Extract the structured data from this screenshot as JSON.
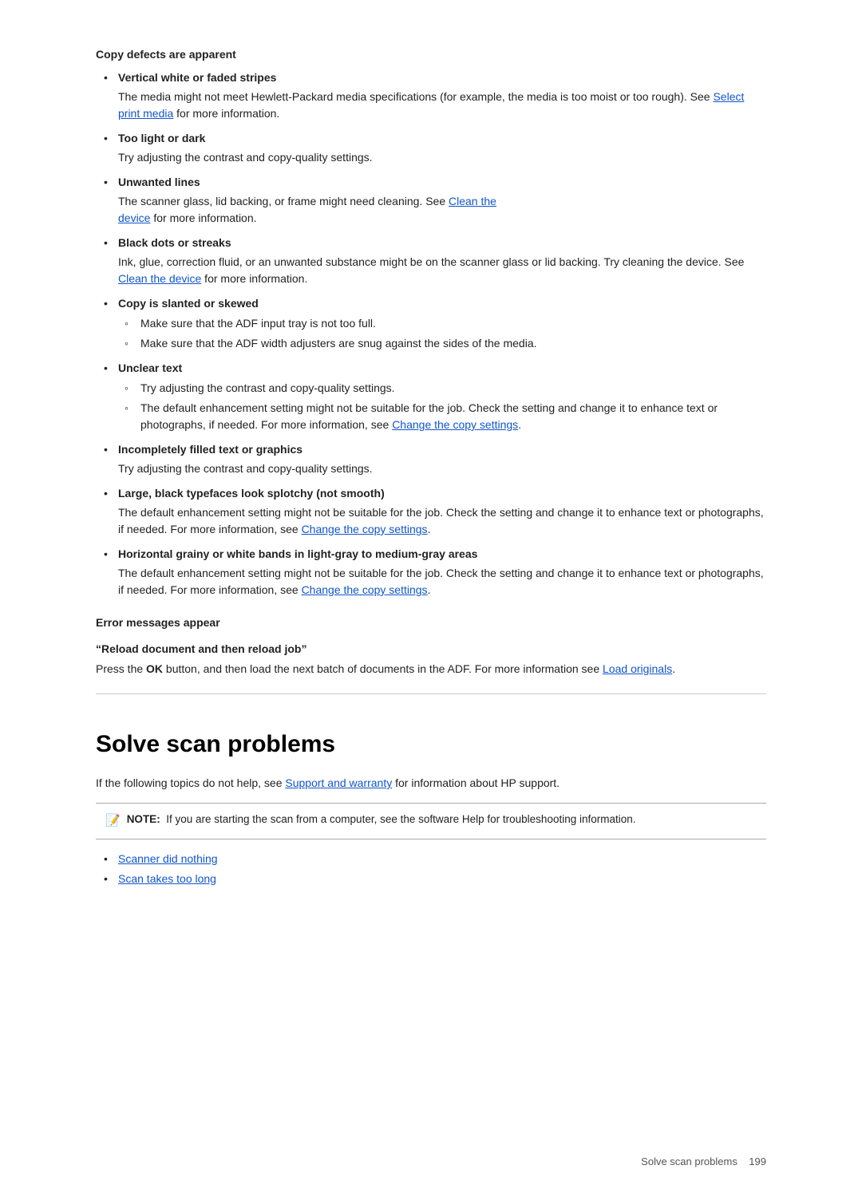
{
  "page": {
    "footer_text": "Solve scan problems",
    "footer_page": "199"
  },
  "copy_defects": {
    "heading": "Copy defects are apparent",
    "items": [
      {
        "title": "Vertical white or faded stripes",
        "body": "The media might not meet Hewlett-Packard media specifications (for example, the media is too moist or too rough). See ",
        "link_text": "Select print media",
        "body_after": " for more information."
      },
      {
        "title": "Too light or dark",
        "body": "Try adjusting the contrast and copy-quality settings."
      },
      {
        "title": "Unwanted lines",
        "body": "The scanner glass, lid backing, or frame might need cleaning. See ",
        "link_text": "Clean the device",
        "body_after": " for more information."
      },
      {
        "title": "Black dots or streaks",
        "body": "Ink, glue, correction fluid, or an unwanted substance might be on the scanner glass or lid backing. Try cleaning the device. See ",
        "link_text": "Clean the device",
        "body_after": " for more information."
      },
      {
        "title": "Copy is slanted or skewed",
        "subitems": [
          "Make sure that the ADF input tray is not too full.",
          "Make sure that the ADF width adjusters are snug against the sides of the media."
        ]
      },
      {
        "title": "Unclear text",
        "subitems": [
          "Try adjusting the contrast and copy-quality settings.",
          "The default enhancement setting might not be suitable for the job. Check the setting and change it to enhance text or photographs, if needed. For more information, see [Change the copy settings]."
        ]
      },
      {
        "title": "Incompletely filled text or graphics",
        "body": "Try adjusting the contrast and copy-quality settings."
      },
      {
        "title": "Large, black typefaces look splotchy (not smooth)",
        "body": "The default enhancement setting might not be suitable for the job. Check the setting and change it to enhance text or photographs, if needed. For more information, see ",
        "link_text": "Change the copy settings",
        "body_after": "."
      },
      {
        "title": "Horizontal grainy or white bands in light-gray to medium-gray areas",
        "body": "The default enhancement setting might not be suitable for the job. Check the setting and change it to enhance text or photographs, if needed. For more information, see ",
        "link_text": "Change the copy settings",
        "body_after": "."
      }
    ]
  },
  "error_messages": {
    "heading": "Error messages appear",
    "sub_heading": "“Reload document and then reload job”",
    "body": "Press the ",
    "bold_ok": "OK",
    "body_after": " button, and then load the next batch of documents in the ADF. For more information see ",
    "link_text": "Load originals",
    "body_end": "."
  },
  "solve_scan": {
    "heading": "Solve scan problems",
    "intro": "If the following topics do not help, see ",
    "link_text": "Support and warranty",
    "intro_after": " for information about HP support.",
    "note_label": "NOTE:",
    "note_body": "If you are starting the scan from a computer, see the software Help for troubleshooting information.",
    "links": [
      {
        "text": "Scanner did nothing"
      },
      {
        "text": "Scan takes too long"
      }
    ]
  },
  "unclear_text_sub2_prefix": "The default enhancement setting might not be suitable for the job. Check the setting and change it to enhance text or photographs, if needed. For more information, see ",
  "unclear_text_sub2_link": "Change the copy settings",
  "unclear_text_sub2_suffix": "."
}
